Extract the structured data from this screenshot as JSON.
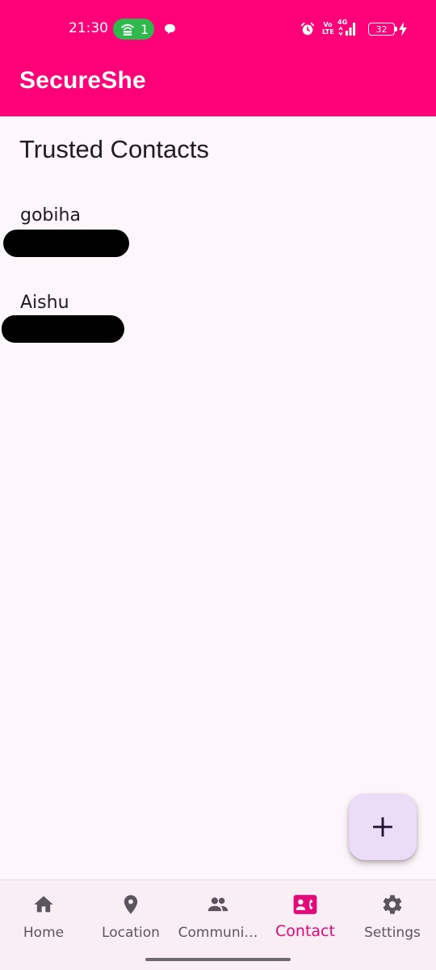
{
  "status_bar": {
    "time": "21:30",
    "hotspot_count": "1",
    "volte_top": "Vo",
    "volte_bottom": "LTE",
    "network": "4G",
    "battery_level": "32"
  },
  "app_bar": {
    "title": "SecureShe",
    "background_color": "#fe0077"
  },
  "page": {
    "title": "Trusted Contacts"
  },
  "contacts": [
    {
      "name": "gobiha"
    },
    {
      "name": "Aishu"
    }
  ],
  "fab": {
    "icon": "plus-icon"
  },
  "bottom_nav": {
    "items": [
      {
        "label": "Home",
        "icon": "home-icon",
        "active": false
      },
      {
        "label": "Location",
        "icon": "location-pin-icon",
        "active": false
      },
      {
        "label": "Communi…",
        "icon": "people-icon",
        "active": false
      },
      {
        "label": "Contact",
        "icon": "contact-phone-icon",
        "active": true
      },
      {
        "label": "Settings",
        "icon": "gear-icon",
        "active": false
      }
    ],
    "active_color": "#e4097a",
    "inactive_color": "#5c5560"
  }
}
